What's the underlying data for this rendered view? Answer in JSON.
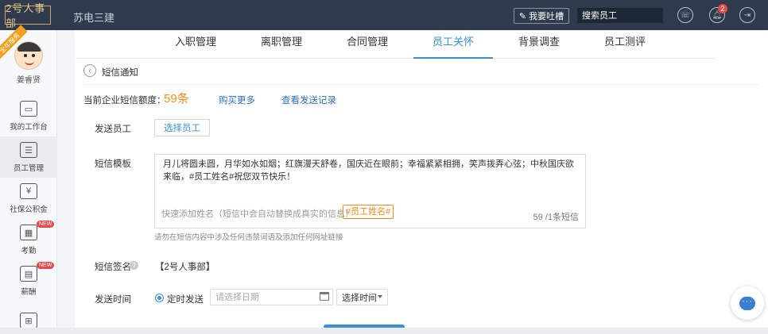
{
  "topbar": {
    "logo": "2号人事部",
    "company": "苏电三建",
    "feedback_label": "我要吐槽",
    "search_placeholder": "搜索员工",
    "notification_count": "2"
  },
  "sidebar": {
    "ribbon": "全年服务",
    "user_name": "姜睿贤",
    "items": [
      {
        "label": "我的工作台",
        "icon": "monitor-icon"
      },
      {
        "label": "员工管理",
        "icon": "employee-search-icon"
      },
      {
        "label": "社保公积金",
        "icon": "house-yuan-icon"
      },
      {
        "label": "考勤",
        "icon": "calendar-icon",
        "badge": "NEW"
      },
      {
        "label": "薪酬",
        "icon": "wallet-icon",
        "badge": "NEW"
      }
    ]
  },
  "tabs": [
    "入职管理",
    "离职管理",
    "合同管理",
    "员工关怀",
    "背景调查",
    "员工测评"
  ],
  "active_tab": "员工关怀",
  "breadcrumb": "短信通知",
  "quota": {
    "label": "当前企业短信额度：",
    "value": "59条",
    "buy_more": "购买更多",
    "view_records": "查看发送记录"
  },
  "form": {
    "send_to_label": "发送员工",
    "select_employee_button": "选择员工",
    "template_label": "短信模板",
    "template_text": "月儿将圆未圆，月华如水如烟；红旗漫天舒卷，国庆近在眼前；幸福紧紧相拥，笑声拨弄心弦；中秋国庆欲来临，#员工姓名#祝您双节快乐！",
    "quick_add_hint": "快速添加姓名（短信中会自动替换成真实的信息）",
    "name_tag": "#员工姓名#",
    "char_count": "59 /1条短信",
    "hint": "请勿在短信内容中涉及任何违禁词语及添加任何网址链接",
    "signature_label": "短信签名",
    "signature_value": "【2号人事部】",
    "send_time_label": "发送时间",
    "scheduled_label": "定时发送",
    "date_placeholder": "请选择日期",
    "time_select": "选择时间"
  },
  "colors": {
    "accent": "#3a8fd6",
    "quota": "#f08c1e",
    "topbar": "#2f3a4c"
  }
}
